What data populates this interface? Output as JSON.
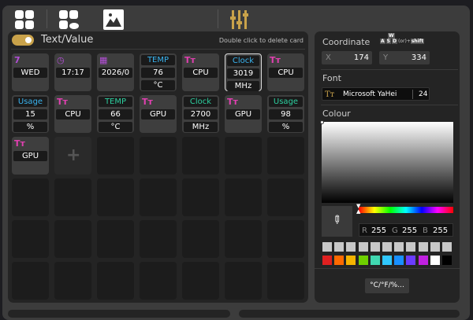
{
  "toolbar": {
    "icons": [
      "grid-icon",
      "grid-cloud-icon",
      "image-icon",
      "sliders-icon"
    ]
  },
  "panel": {
    "title": "Text/Value",
    "hint": "Double click to delete card"
  },
  "cards": [
    {
      "icon": "calendar-day-icon",
      "glyph": "7",
      "color": "#b44fd8",
      "value": "WED"
    },
    {
      "icon": "clock-icon",
      "glyph": "◷",
      "color": "#b44fd8",
      "value": "17:17"
    },
    {
      "icon": "calendar-icon",
      "glyph": "▦",
      "color": "#b44fd8",
      "value": "2026/0"
    },
    {
      "label": "TEMP",
      "color": "#3ab4f0",
      "value": "76",
      "unit": "°C"
    },
    {
      "icon": "text-icon",
      "glyph": "Tт",
      "color": "#e040b0",
      "value": "CPU"
    },
    {
      "label": "Clock",
      "color": "#3ab4f0",
      "value": "3019",
      "unit": "MHz",
      "selected": true
    },
    {
      "icon": "text-icon",
      "glyph": "Tт",
      "color": "#e040b0",
      "value": "CPU"
    },
    {
      "label": "Usage",
      "color": "#3ab4f0",
      "value": "15",
      "unit": "%"
    },
    {
      "icon": "text-icon",
      "glyph": "Tт",
      "color": "#e040b0",
      "value": "CPU"
    },
    {
      "label": "TEMP",
      "color": "#2dcf9f",
      "value": "66",
      "unit": "°C"
    },
    {
      "icon": "text-icon",
      "glyph": "Tт",
      "color": "#e040b0",
      "value": "GPU"
    },
    {
      "label": "Clock",
      "color": "#2dcf9f",
      "value": "2700",
      "unit": "MHz"
    },
    {
      "icon": "text-icon",
      "glyph": "Tт",
      "color": "#e040b0",
      "value": "GPU"
    },
    {
      "label": "Usage",
      "color": "#2dcf9f",
      "value": "98",
      "unit": "%"
    },
    {
      "icon": "text-icon",
      "glyph": "Tт",
      "color": "#e040b0",
      "value": "GPU"
    }
  ],
  "add_label": "+",
  "coordinate": {
    "label": "Coordinate",
    "x_label": "X",
    "x": "174",
    "y_label": "Y",
    "y": "334",
    "keys": [
      "W",
      "A",
      "S",
      "D"
    ],
    "or": "(or)+",
    "shift": "shift"
  },
  "font": {
    "label": "Font",
    "name": "Microsoft YaHei",
    "size": "24",
    "icon_glyph": "Tт"
  },
  "colour": {
    "label": "Colour",
    "r_label": "R",
    "r": "255",
    "g_label": "G",
    "g": "255",
    "b_label": "B",
    "b": "255",
    "swatches_top": [
      "#c8c8c8",
      "#c8c8c8",
      "#c8c8c8",
      "#c8c8c8",
      "#c8c8c8",
      "#c8c8c8",
      "#c8c8c8",
      "#c8c8c8",
      "#c8c8c8",
      "#c8c8c8",
      "#c8c8c8"
    ],
    "swatches": [
      "#e02020",
      "#ff6a00",
      "#f5b400",
      "#6fd000",
      "#40d8b0",
      "#30c8ff",
      "#1890ff",
      "#6a3cff",
      "#c020e0",
      "#ffffff",
      "#000000"
    ]
  },
  "units_button": "°C/°F/%..."
}
